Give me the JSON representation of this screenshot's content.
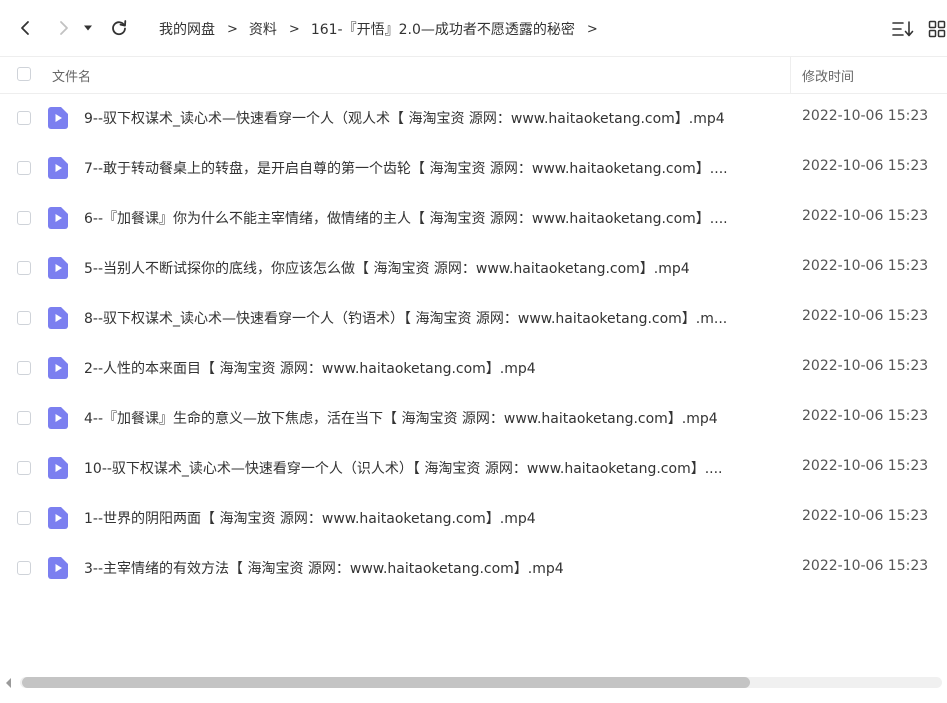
{
  "toolbar": {
    "back_icon": "chevron-left-icon",
    "forward_icon": "chevron-right-icon",
    "history_icon": "caret-down-icon",
    "refresh_icon": "refresh-icon",
    "sort_icon": "sort-icon",
    "view_icon": "grid-view-icon"
  },
  "breadcrumb": {
    "items": [
      "我的网盘",
      "资料",
      "161-『开悟』2.0—成功者不愿透露的秘密"
    ],
    "separator": ">"
  },
  "header": {
    "name_label": "文件名",
    "time_label": "修改时间"
  },
  "files": [
    {
      "name": "9--驭下权谋术_读心术—快速看穿一个人（观人术【 海淘宝资 源网：www.haitaoketang.com】.mp4",
      "time": "2022-10-06 15:23"
    },
    {
      "name": "7--敢于转动餐桌上的转盘，是开启自尊的第一个齿轮【 海淘宝资 源网：www.haitaoketang.com】....",
      "time": "2022-10-06 15:23"
    },
    {
      "name": "6--『加餐课』你为什么不能主宰情绪，做情绪的主人【 海淘宝资 源网：www.haitaoketang.com】....",
      "time": "2022-10-06 15:23"
    },
    {
      "name": "5--当别人不断试探你的底线，你应该怎么做【 海淘宝资 源网：www.haitaoketang.com】.mp4",
      "time": "2022-10-06 15:23"
    },
    {
      "name": "8--驭下权谋术_读心术—快速看穿一个人（钓语术）【 海淘宝资 源网：www.haitaoketang.com】.m...",
      "time": "2022-10-06 15:23"
    },
    {
      "name": "2--人性的本来面目【 海淘宝资 源网：www.haitaoketang.com】.mp4",
      "time": "2022-10-06 15:23"
    },
    {
      "name": "4--『加餐课』生命的意义—放下焦虑，活在当下【 海淘宝资 源网：www.haitaoketang.com】.mp4",
      "time": "2022-10-06 15:23"
    },
    {
      "name": "10--驭下权谋术_读心术—快速看穿一个人（识人术）【 海淘宝资 源网：www.haitaoketang.com】....",
      "time": "2022-10-06 15:23"
    },
    {
      "name": "1--世界的阴阳两面【 海淘宝资 源网：www.haitaoketang.com】.mp4",
      "time": "2022-10-06 15:23"
    },
    {
      "name": "3--主宰情绪的有效方法【 海淘宝资 源网：www.haitaoketang.com】.mp4",
      "time": "2022-10-06 15:23"
    }
  ],
  "colors": {
    "video_icon": "#7b7ff0",
    "text": "#333333",
    "muted": "#666666",
    "divider": "#eeeeee"
  }
}
